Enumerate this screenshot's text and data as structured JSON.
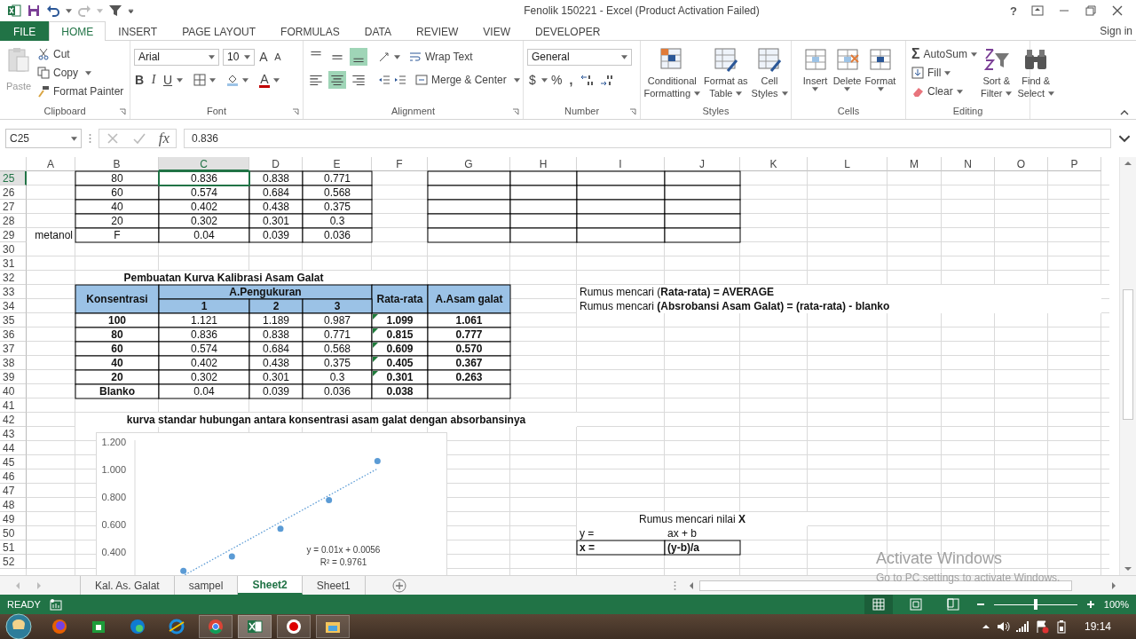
{
  "title_bar": {
    "title": "Fenolik 150221 - Excel (Product Activation Failed)",
    "help": "?"
  },
  "tabs": [
    {
      "label": "FILE",
      "kind": "file",
      "selected": false
    },
    {
      "label": "HOME",
      "kind": "tab",
      "selected": true
    },
    {
      "label": "INSERT",
      "kind": "tab",
      "selected": false
    },
    {
      "label": "PAGE LAYOUT",
      "kind": "tab",
      "selected": false
    },
    {
      "label": "FORMULAS",
      "kind": "tab",
      "selected": false
    },
    {
      "label": "DATA",
      "kind": "tab",
      "selected": false
    },
    {
      "label": "REVIEW",
      "kind": "tab",
      "selected": false
    },
    {
      "label": "VIEW",
      "kind": "tab",
      "selected": false
    },
    {
      "label": "DEVELOPER",
      "kind": "tab",
      "selected": false
    }
  ],
  "sign_in": "Sign in",
  "clipboard": {
    "paste": "Paste",
    "cut": "Cut",
    "copy": "Copy",
    "format_painter": "Format Painter",
    "label": "Clipboard"
  },
  "font": {
    "name": "Arial",
    "size": "10",
    "grow": "A",
    "shrink": "A",
    "bold": "B",
    "italic": "I",
    "underline": "U",
    "font_color": "A",
    "label": "Font"
  },
  "alignment": {
    "vertical": [
      {
        "selected": false
      },
      {
        "selected": false
      },
      {
        "selected": true
      }
    ],
    "horizontal": [
      {
        "selected": false
      },
      {
        "selected": true
      },
      {
        "selected": false
      }
    ],
    "wrap": "Wrap Text",
    "merge": "Merge & Center",
    "label": "Alignment"
  },
  "number": {
    "format": "General",
    "currency": "$",
    "percent": "%",
    "comma": ",",
    "label": "Number"
  },
  "styles": {
    "buttons": [
      {
        "line1": "Conditional",
        "line2": "Formatting"
      },
      {
        "line1": "Format as",
        "line2": "Table"
      },
      {
        "line1": "Cell",
        "line2": "Styles"
      }
    ],
    "label": "Styles"
  },
  "cells_group": {
    "buttons": [
      "Insert",
      "Delete",
      "Format"
    ],
    "label": "Cells"
  },
  "editing": {
    "sigma": "Σ",
    "autosum": "AutoSum",
    "fill": "Fill",
    "clear": "Clear",
    "sort": {
      "line1": "Sort &",
      "line2": "Filter"
    },
    "find": {
      "line1": "Find &",
      "line2": "Select"
    },
    "label": "Editing"
  },
  "formula_bar": {
    "name_box": "C25",
    "fx": "fx",
    "value": "0.836"
  },
  "columns": [
    {
      "label": "A",
      "selected": false
    },
    {
      "label": "B",
      "selected": false
    },
    {
      "label": "C",
      "selected": true
    },
    {
      "label": "D",
      "selected": false
    },
    {
      "label": "E",
      "selected": false
    },
    {
      "label": "F",
      "selected": false
    },
    {
      "label": "G",
      "selected": false
    },
    {
      "label": "H",
      "selected": false
    },
    {
      "label": "I",
      "selected": false
    },
    {
      "label": "J",
      "selected": false
    },
    {
      "label": "K",
      "selected": false
    },
    {
      "label": "L",
      "selected": false
    },
    {
      "label": "M",
      "selected": false
    },
    {
      "label": "N",
      "selected": false
    },
    {
      "label": "O",
      "selected": false
    },
    {
      "label": "P",
      "selected": false
    }
  ],
  "rows": [
    {
      "number": "25",
      "selected": true,
      "cells": {
        "B": {
          "text": "80",
          "kind": "box"
        },
        "C": {
          "text": "0.836",
          "kind": "box"
        },
        "D": {
          "text": "0.838",
          "kind": "box"
        },
        "E": {
          "text": "0.771",
          "kind": "box"
        },
        "G": {
          "kind": "box"
        },
        "H": {
          "kind": "box"
        },
        "I": {
          "kind": "box"
        },
        "J": {
          "kind": "box"
        }
      }
    },
    {
      "number": "26",
      "selected": false,
      "cells": {
        "B": {
          "text": "60",
          "kind": "box"
        },
        "C": {
          "text": "0.574",
          "kind": "box"
        },
        "D": {
          "text": "0.684",
          "kind": "box"
        },
        "E": {
          "text": "0.568",
          "kind": "box"
        },
        "G": {
          "kind": "box"
        },
        "H": {
          "kind": "box"
        },
        "I": {
          "kind": "box"
        },
        "J": {
          "kind": "box"
        }
      }
    },
    {
      "number": "27",
      "selected": false,
      "cells": {
        "B": {
          "text": "40",
          "kind": "box"
        },
        "C": {
          "text": "0.402",
          "kind": "box"
        },
        "D": {
          "text": "0.438",
          "kind": "box"
        },
        "E": {
          "text": "0.375",
          "kind": "box"
        },
        "G": {
          "kind": "box"
        },
        "H": {
          "kind": "box"
        },
        "I": {
          "kind": "box"
        },
        "J": {
          "kind": "box"
        }
      }
    },
    {
      "number": "28",
      "selected": false,
      "cells": {
        "B": {
          "text": "20",
          "kind": "box"
        },
        "C": {
          "text": "0.302",
          "kind": "box"
        },
        "D": {
          "text": "0.301",
          "kind": "box"
        },
        "E": {
          "text": "0.3",
          "kind": "box"
        },
        "G": {
          "kind": "box"
        },
        "H": {
          "kind": "box"
        },
        "I": {
          "kind": "box"
        },
        "J": {
          "kind": "box"
        }
      }
    },
    {
      "number": "29",
      "selected": false,
      "cells": {
        "A": {
          "text": "metanol",
          "kind": "plain_right"
        },
        "B": {
          "text": "F",
          "kind": "box"
        },
        "C": {
          "text": "0.04",
          "kind": "box"
        },
        "D": {
          "text": "0.039",
          "kind": "box"
        },
        "E": {
          "text": "0.036",
          "kind": "box"
        },
        "G": {
          "kind": "box"
        },
        "H": {
          "kind": "box"
        },
        "I": {
          "kind": "box"
        },
        "J": {
          "kind": "box"
        }
      }
    },
    {
      "number": "30",
      "selected": false
    },
    {
      "number": "31",
      "selected": false
    },
    {
      "number": "32",
      "selected": false,
      "cells": {
        "B-E": {
          "text": "Pembuatan Kurva Kalibrasi Asam Galat",
          "kind": "title"
        }
      }
    },
    {
      "number": "33",
      "selected": false,
      "cells": {
        "B/2": {
          "text": "Konsentrasi",
          "kind": "header"
        },
        "C-E": {
          "text": "A.Pengukuran",
          "kind": "header"
        },
        "F/2": {
          "text": "Rata-rata",
          "kind": "header"
        },
        "G/2": {
          "text": "A.Asam galat",
          "kind": "header"
        },
        "I-P": {
          "text": "Rumus mencari (**Rata-rata) = AVERAGE**",
          "kind": "note"
        }
      }
    },
    {
      "number": "34",
      "selected": false,
      "cells": {
        "C": {
          "text": "1",
          "kind": "header"
        },
        "D": {
          "text": "2",
          "kind": "header"
        },
        "E": {
          "text": "3",
          "kind": "header"
        },
        "I-P": {
          "text": "Rumus mencari **(Absrobansi Asam Galat) = (rata-rata) - blanko**",
          "kind": "note"
        }
      }
    },
    {
      "number": "35",
      "selected": false,
      "cells": {
        "B": {
          "text": "100",
          "kind": "box_bold"
        },
        "C": {
          "text": "1.121",
          "kind": "box"
        },
        "D": {
          "text": "1.189",
          "kind": "box"
        },
        "E": {
          "text": "0.987",
          "kind": "box"
        },
        "F": {
          "text": "1.099",
          "kind": "box_bold",
          "error_flag": true
        },
        "G": {
          "text": "1.061",
          "kind": "box_bold"
        }
      }
    },
    {
      "number": "36",
      "selected": false,
      "cells": {
        "B": {
          "text": "80",
          "kind": "box_bold"
        },
        "C": {
          "text": "0.836",
          "kind": "box"
        },
        "D": {
          "text": "0.838",
          "kind": "box"
        },
        "E": {
          "text": "0.771",
          "kind": "box"
        },
        "F": {
          "text": "0.815",
          "kind": "box_bold",
          "error_flag": true
        },
        "G": {
          "text": "0.777",
          "kind": "box_bold"
        }
      }
    },
    {
      "number": "37",
      "selected": false,
      "cells": {
        "B": {
          "text": "60",
          "kind": "box_bold"
        },
        "C": {
          "text": "0.574",
          "kind": "box"
        },
        "D": {
          "text": "0.684",
          "kind": "box"
        },
        "E": {
          "text": "0.568",
          "kind": "box"
        },
        "F": {
          "text": "0.609",
          "kind": "box_bold",
          "error_flag": true
        },
        "G": {
          "text": "0.570",
          "kind": "box_bold"
        }
      }
    },
    {
      "number": "38",
      "selected": false,
      "cells": {
        "B": {
          "text": "40",
          "kind": "box_bold"
        },
        "C": {
          "text": "0.402",
          "kind": "box"
        },
        "D": {
          "text": "0.438",
          "kind": "box"
        },
        "E": {
          "text": "0.375",
          "kind": "box"
        },
        "F": {
          "text": "0.405",
          "kind": "box_bold",
          "error_flag": true
        },
        "G": {
          "text": "0.367",
          "kind": "box_bold"
        }
      }
    },
    {
      "number": "39",
      "selected": false,
      "cells": {
        "B": {
          "text": "20",
          "kind": "box_bold"
        },
        "C": {
          "text": "0.302",
          "kind": "box"
        },
        "D": {
          "text": "0.301",
          "kind": "box"
        },
        "E": {
          "text": "0.3",
          "kind": "box"
        },
        "F": {
          "text": "0.301",
          "kind": "box_bold",
          "error_flag": true
        },
        "G": {
          "text": "0.263",
          "kind": "box_bold"
        }
      }
    },
    {
      "number": "40",
      "selected": false,
      "cells": {
        "B": {
          "text": "Blanko",
          "kind": "box_bold"
        },
        "C": {
          "text": "0.04",
          "kind": "box"
        },
        "D": {
          "text": "0.039",
          "kind": "box"
        },
        "E": {
          "text": "0.036",
          "kind": "box"
        },
        "F": {
          "text": "0.038",
          "kind": "box_bold"
        },
        "G": {
          "kind": "box"
        }
      }
    },
    {
      "number": "41",
      "selected": false
    },
    {
      "number": "42",
      "selected": false,
      "cells": {
        "B-H": {
          "text": "kurva standar hubungan antara konsentrasi asam galat dengan absorbansinya",
          "kind": "title"
        }
      }
    },
    {
      "number": "43",
      "selected": false
    },
    {
      "number": "44",
      "selected": false
    },
    {
      "number": "45",
      "selected": false
    },
    {
      "number": "46",
      "selected": false
    },
    {
      "number": "47",
      "selected": false
    },
    {
      "number": "48",
      "selected": false
    },
    {
      "number": "49",
      "selected": false,
      "cells": {
        "I-K": {
          "text": "Rumus mencari nilai **X**",
          "kind": "note_center"
        }
      }
    },
    {
      "number": "50",
      "selected": false,
      "cells": {
        "I": {
          "text": "y =",
          "kind": "plain"
        },
        "J": {
          "text": "ax + b",
          "kind": "plain"
        }
      }
    },
    {
      "number": "51",
      "selected": false,
      "cells": {
        "I": {
          "text": "x =",
          "kind": "box_bold_left"
        },
        "J": {
          "text": "(y-b)/a",
          "kind": "box_bold_left"
        }
      }
    },
    {
      "number": "52",
      "selected": false
    }
  ],
  "chart": {
    "axis_labels": [
      "1.200",
      "1.000",
      "0.800",
      "0.600",
      "0.400"
    ],
    "trendline_labels": [
      "y = 0.01x + 0.0056",
      "R² = 0.9761"
    ]
  },
  "sheet_tabs": [
    {
      "label": "Kal. As. Galat",
      "selected": false
    },
    {
      "label": "sampel",
      "selected": false
    },
    {
      "label": "Sheet2",
      "selected": true
    },
    {
      "label": "Sheet1",
      "selected": false
    }
  ],
  "status_bar": {
    "status": "READY",
    "views": [
      {
        "selected": true
      },
      {
        "selected": false
      },
      {
        "selected": false
      }
    ],
    "zoom": {
      "level": 0.5
    },
    "zoom_label": "100%"
  },
  "taskbar": {
    "items": [
      {
        "running": false,
        "selected": false
      },
      {
        "running": false,
        "selected": false
      },
      {
        "running": false,
        "selected": false
      },
      {
        "running": false,
        "selected": false
      },
      {
        "running": true,
        "selected": false
      },
      {
        "running": true,
        "selected": true
      },
      {
        "running": true,
        "selected": false
      },
      {
        "running": true,
        "selected": false
      }
    ],
    "time": "19:14"
  },
  "activation_notice": {
    "title": "Activate Windows",
    "text": "Go to PC settings to activate Windows."
  }
}
